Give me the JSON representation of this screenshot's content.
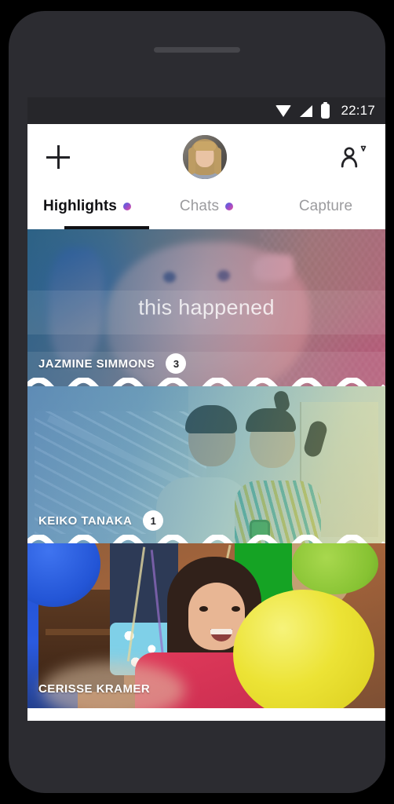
{
  "status_bar": {
    "time": "22:17",
    "icons": [
      "wifi-icon",
      "signal-icon",
      "battery-icon"
    ]
  },
  "app_bar": {
    "add_icon": "plus-icon",
    "avatar_label": "profile-avatar",
    "friend_icon": "add-friend-icon"
  },
  "tabs": [
    {
      "label": "Highlights",
      "active": true,
      "has_dot": true
    },
    {
      "label": "Chats",
      "active": false,
      "has_dot": true
    },
    {
      "label": "Capture",
      "active": false,
      "has_dot": false
    }
  ],
  "feed": {
    "caption": "this happened",
    "cards": [
      {
        "name": "JAZMINE SIMMONS",
        "badge": "3",
        "has_badge": true,
        "has_caption": true
      },
      {
        "name": "KEIKO TANAKA",
        "badge": "1",
        "has_badge": true,
        "has_caption": false
      },
      {
        "name": "CERISSE KRAMER",
        "badge": "",
        "has_badge": false,
        "has_caption": false
      }
    ]
  },
  "colors": {
    "frame": "#2c2c31",
    "status_bar": "#26262a",
    "accent_dot_start": "#3f6fe0",
    "accent_dot_end": "#e5509b",
    "active_tab_text": "#111114",
    "inactive_tab_text": "#9b9b9e",
    "badge_bg": "#ffffff",
    "wave": "#ffffff"
  }
}
